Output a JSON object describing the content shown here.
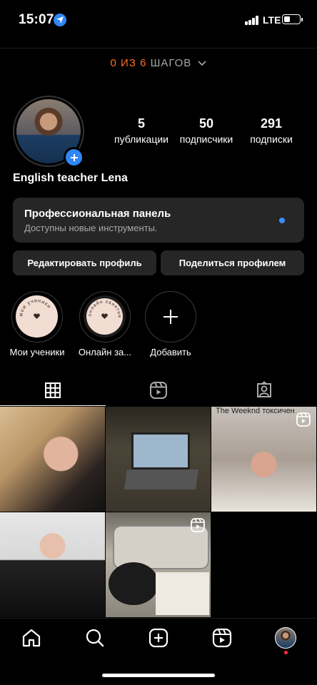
{
  "status_bar": {
    "time": "15:07",
    "network": "LTE",
    "icons": [
      "location-arrow-icon",
      "signal-icon",
      "battery-icon"
    ]
  },
  "steps": {
    "done": "0",
    "of": "ИЗ",
    "total": "6",
    "label": "ШАГОВ"
  },
  "profile": {
    "name": "English teacher Lena",
    "stats": [
      {
        "value": "5",
        "label": "публикации"
      },
      {
        "value": "50",
        "label": "подписчики"
      },
      {
        "value": "291",
        "label": "подписки"
      }
    ]
  },
  "pro_panel": {
    "title": "Профессиональная панель",
    "subtitle": "Доступны новые инструменты."
  },
  "buttons": {
    "edit": "Редактировать профиль",
    "share": "Поделиться профилем"
  },
  "highlights": [
    {
      "label": "Мои ученики",
      "ring_text": "мои ученики"
    },
    {
      "label": "Онлайн за...",
      "ring_text": "онлайн занятия"
    },
    {
      "label": "Добавить"
    }
  ],
  "grid": {
    "overlay_song_text": "The Weeknd токсичен"
  },
  "colors": {
    "accent_orange": "#ff6d22",
    "accent_blue": "#2f86f6",
    "surface": "#262626"
  }
}
